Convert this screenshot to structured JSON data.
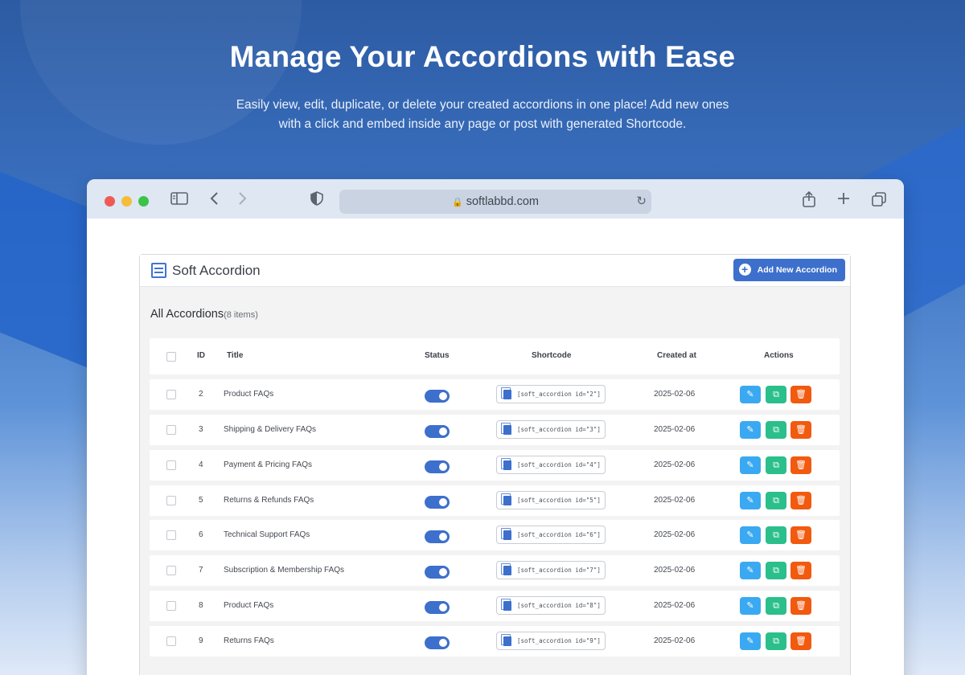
{
  "hero": {
    "title": "Manage Your Accordions with Ease",
    "subtitle": "Easily view, edit, duplicate, or delete your created accordions in one place! Add new ones with a click and embed inside any page or post with generated Shortcode."
  },
  "browser": {
    "url": "softlabbd.com"
  },
  "plugin": {
    "title": "Soft Accordion",
    "add_button": "Add New Accordion",
    "section_title": "All Accordions",
    "section_count": "(8 items)"
  },
  "table": {
    "headers": {
      "id": "ID",
      "title": "Title",
      "status": "Status",
      "shortcode": "Shortcode",
      "created": "Created at",
      "actions": "Actions"
    },
    "rows": [
      {
        "id": "2",
        "title": "Product FAQs",
        "shortcode": "[soft_accordion id=\"2\"]",
        "created": "2025-02-06",
        "status_on": true
      },
      {
        "id": "3",
        "title": "Shipping & Delivery FAQs",
        "shortcode": "[soft_accordion id=\"3\"]",
        "created": "2025-02-06",
        "status_on": true
      },
      {
        "id": "4",
        "title": "Payment & Pricing FAQs",
        "shortcode": "[soft_accordion id=\"4\"]",
        "created": "2025-02-06",
        "status_on": true
      },
      {
        "id": "5",
        "title": "Returns & Refunds FAQs",
        "shortcode": "[soft_accordion id=\"5\"]",
        "created": "2025-02-06",
        "status_on": true
      },
      {
        "id": "6",
        "title": "Technical Support FAQs",
        "shortcode": "[soft_accordion id=\"6\"]",
        "created": "2025-02-06",
        "status_on": true
      },
      {
        "id": "7",
        "title": "Subscription & Membership FAQs",
        "shortcode": "[soft_accordion id=\"7\"]",
        "created": "2025-02-06",
        "status_on": true
      },
      {
        "id": "8",
        "title": "Product FAQs",
        "shortcode": "[soft_accordion id=\"8\"]",
        "created": "2025-02-06",
        "status_on": true
      },
      {
        "id": "9",
        "title": "Returns FAQs",
        "shortcode": "[soft_accordion id=\"9\"]",
        "created": "2025-02-06",
        "status_on": true
      }
    ]
  },
  "colors": {
    "accent": "#3d6fcc",
    "edit": "#3aa9f1",
    "duplicate": "#2bbf8c",
    "delete": "#f15a0f"
  },
  "icons": {
    "edit": "pencil-icon",
    "duplicate": "copy-icon",
    "delete": "trash-icon"
  }
}
